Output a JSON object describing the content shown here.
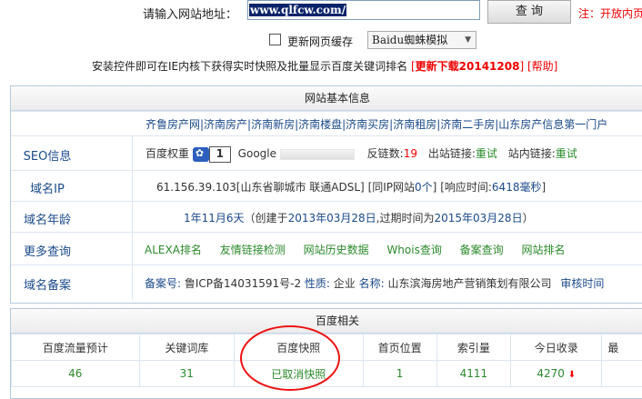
{
  "top": {
    "url_label": "请输入网站地址：",
    "url_value": "www.qlfcw.com/",
    "query_button": "查 询",
    "note": "注：开放内页"
  },
  "options": {
    "refresh_cache": "更新网页缓存",
    "spider_select": "Baidu蜘蛛模拟"
  },
  "install": {
    "text": "安装控件即可在IE内核下获得实时快照及批量显示百度关键词排名",
    "bracket_open": "[",
    "download": "更新下载20141208",
    "bracket_close": "]",
    "help": "[帮助]"
  },
  "basic": {
    "title": "网站基本信息",
    "keywords": "齐鲁房产网|济南房产|济南新房|济南楼盘|济南买房|济南租房|济南二手房|山东房产信息第一门户",
    "seo": {
      "label": "SEO信息",
      "baidu_weight_label": "百度权重",
      "baidu_weight": "1",
      "google_label": "Google",
      "backlinks_label": "反链数:",
      "backlinks": "19",
      "outbound_label": "出站链接:",
      "outbound": "重试",
      "internal_label": "站内链接:",
      "internal": "重试"
    },
    "ip": {
      "label": "域名IP",
      "value": "61.156.39.103[山东省聊城市 联通ADSL]",
      "same_ip_prefix": "[同IP网站",
      "same_ip_count": "0个",
      "same_ip_suffix": "]",
      "response_prefix": "[响应时间:",
      "response": "6418毫秒",
      "response_suffix": "]"
    },
    "age": {
      "label": "域名年龄",
      "value": "1年11月6天",
      "created_prefix": "（创建于",
      "created": "2013年03月28日",
      "expire_prefix": ",过期时间为",
      "expire": "2015年03月28日",
      "close": "）"
    },
    "more": {
      "label": "更多查询",
      "links": [
        "ALEXA排名",
        "友情链接检测",
        "网站历史数据",
        "Whois查询",
        "备案查询",
        "网站排名"
      ]
    },
    "icp": {
      "label": "域名备案",
      "no_label": "备案号:",
      "no": "鲁ICP备14031591号-2",
      "nature_label": "性质:",
      "nature": "企业",
      "name_label": "名称:",
      "name": "山东滨海房地产营销策划有限公司",
      "review_label": "审核时间"
    }
  },
  "baidu": {
    "title": "百度相关",
    "headers": [
      "百度流量预计",
      "关键词库",
      "百度快照",
      "首页位置",
      "索引量",
      "今日收录",
      "最"
    ],
    "values": [
      "46",
      "31",
      "已取消快照",
      "1",
      "4111",
      "4270",
      ""
    ],
    "trend_icon": "arrow-down-icon"
  }
}
